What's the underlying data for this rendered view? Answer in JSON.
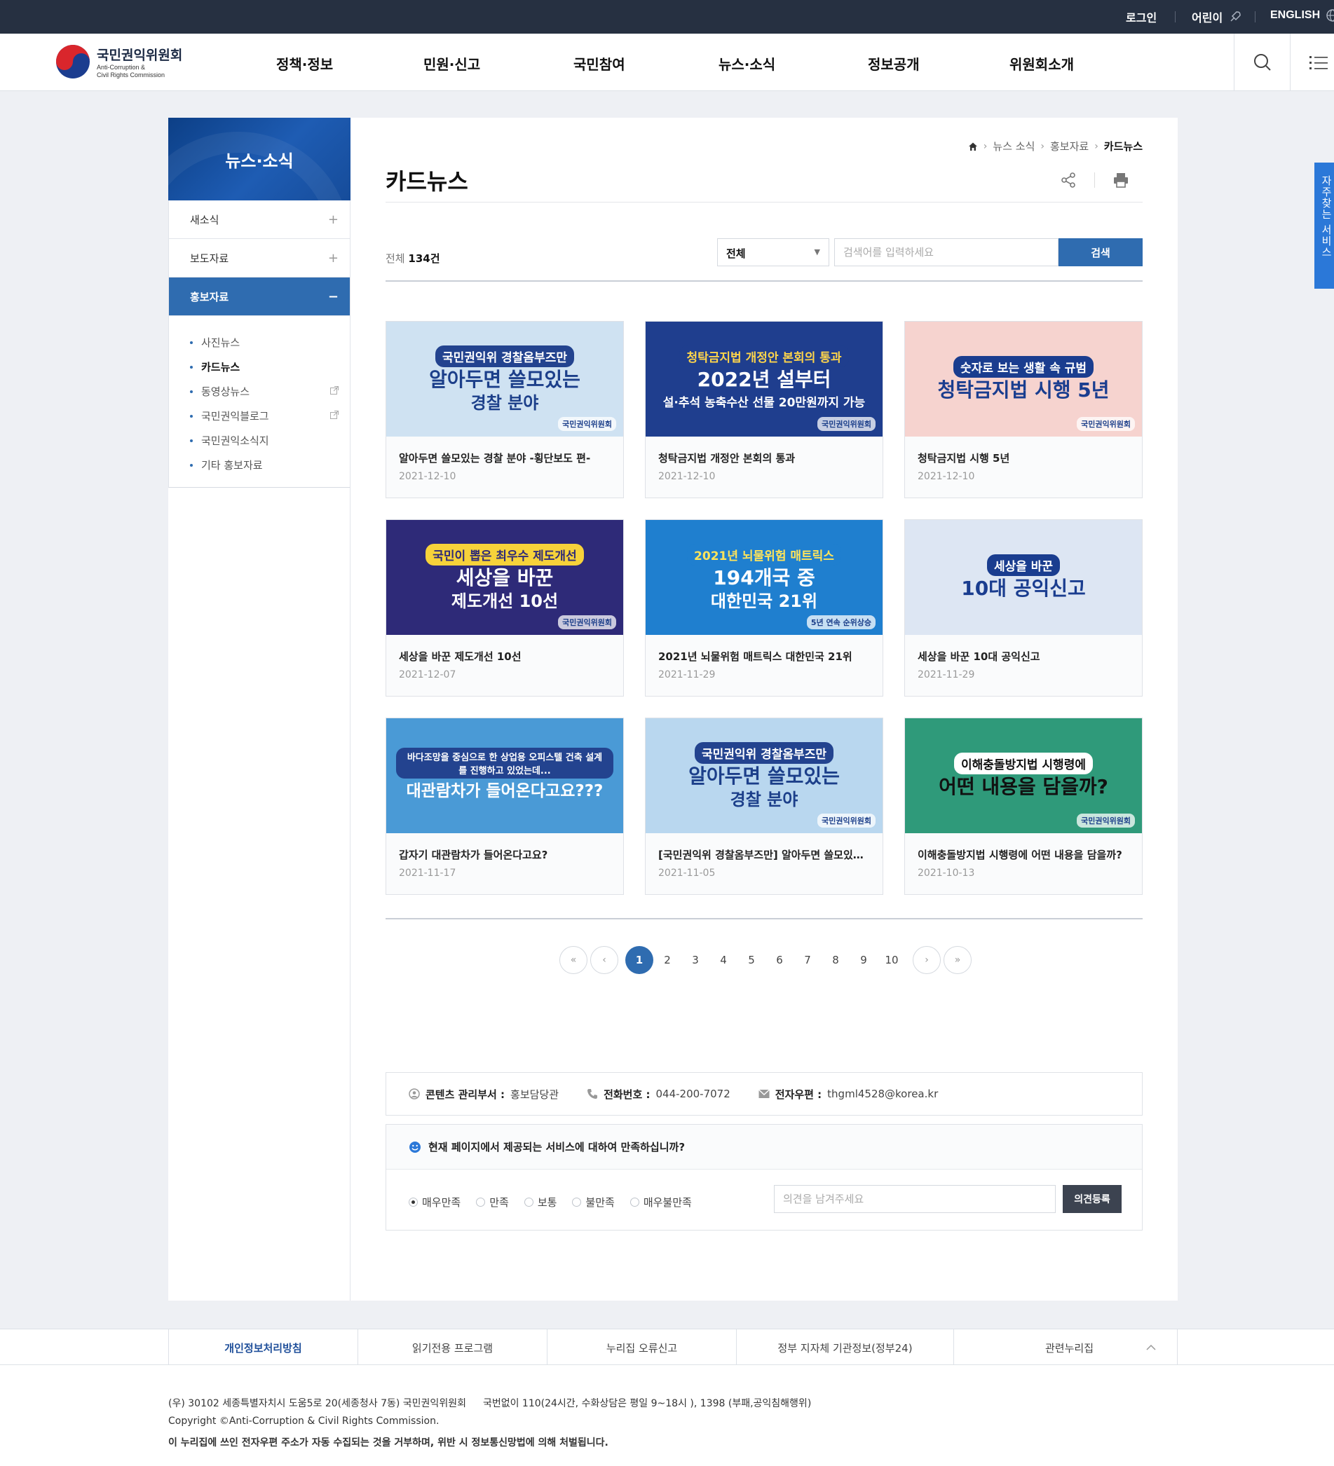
{
  "topbar": {
    "login": "로그인",
    "kids": "어린이",
    "english": "ENGLISH"
  },
  "logo": {
    "name_ko": "국민권익위원회",
    "name_en_1": "Anti-Corruption &",
    "name_en_2": "Civil Rights Commission"
  },
  "gnb": [
    "정책·정보",
    "민원·신고",
    "국민참여",
    "뉴스·소식",
    "정보공개",
    "위원회소개"
  ],
  "quick_tab": "자주찾는 서비스",
  "lnb": {
    "title": "뉴스·소식",
    "items": [
      {
        "label": "새소식",
        "sign": "+"
      },
      {
        "label": "보도자료",
        "sign": "+"
      },
      {
        "label": "홍보자료",
        "sign": "−"
      }
    ],
    "sub_items": [
      "사진뉴스",
      "카드뉴스",
      "동영상뉴스",
      "국민권익블로그",
      "국민권익소식지",
      "기타 홍보자료"
    ]
  },
  "breadcrumb": [
    "뉴스 소식",
    "홍보자료",
    "카드뉴스"
  ],
  "page_title": "카드뉴스",
  "list": {
    "count_label": "전체",
    "count_value": "134건",
    "select_value": "전체",
    "search_placeholder": "검색어를 입력하세요",
    "search_button": "검색"
  },
  "cards": [
    {
      "title": "알아두면 쓸모있는 경찰 분야 -횡단보도 편-",
      "date": "2021-12-10",
      "thumb": {
        "t1": "국민권익위 경찰옴부즈만",
        "t2": "알아두면 쓸모있는",
        "t3": "경찰 분야",
        "brand": "국민권익위원회",
        "bg": "#cfe2f2",
        "fg": "#1c3f8a",
        "pill": "#23438f",
        "pillfg": "#ffffff"
      }
    },
    {
      "title": "청탁금지법 개정안 본회의 통과",
      "date": "2021-12-10",
      "thumb": {
        "t1": "청탁금지법 개정안 본회의 통과",
        "t2": "2022년 설부터",
        "t3": "설·추석 농축수산 선물 20만원까지 가능",
        "brand": "국민권익위원회",
        "bg": "#1f3e8e",
        "fg": "#ffffff",
        "pill": "#1f3e8e",
        "pillfg": "#ffd54a"
      }
    },
    {
      "title": "청탁금지법 시행 5년",
      "date": "2021-12-10",
      "thumb": {
        "t1": "숫자로 보는 생활 속 규범",
        "t2": "청탁금지법 시행 5년",
        "t3": "",
        "brand": "국민권익위원회",
        "bg": "#f6d3cf",
        "fg": "#1a3d8f",
        "pill": "#1a3d8f",
        "pillfg": "#ffffff"
      }
    },
    {
      "title": "세상을 바꾼 제도개선 10선",
      "date": "2021-12-07",
      "thumb": {
        "t1": "국민이 뽑은 최우수 제도개선",
        "t2": "세상을 바꾼",
        "t3": "제도개선 10선",
        "brand": "국민권익위원회",
        "bg": "#2e2a78",
        "fg": "#ffffff",
        "pill": "#f7d23a",
        "pillfg": "#2e2a78"
      }
    },
    {
      "title": "2021년 뇌물위험 매트릭스 대한민국 21위",
      "date": "2021-11-29",
      "thumb": {
        "t1": "2021년 뇌물위험 매트릭스",
        "t2": "194개국 중",
        "t3": "대한민국 21위",
        "brand": "5년 연속 순위상승",
        "bg": "#1f7fcf",
        "fg": "#ffffff",
        "pill": "#1f7fcf",
        "pillfg": "#ffe45a"
      }
    },
    {
      "title": "세상을 바꾼 10대 공익신고",
      "date": "2021-11-29",
      "thumb": {
        "t1": "세상을 바꾼",
        "t2": "10대 공익신고",
        "t3": "",
        "brand": "",
        "bg": "#dde6f3",
        "fg": "#1a3d8f",
        "pill": "#1a3d8f",
        "pillfg": "#ffffff"
      }
    },
    {
      "title": "갑자기 대관람차가 들어온다고요?",
      "date": "2021-11-17",
      "thumb": {
        "t1": "바다조망을 중심으로 한 상업용 오피스텔 건축 설계를 진행하고 있었는데...",
        "t2": "대관람차가 들어온다고요???",
        "t3": "",
        "brand": "",
        "bg": "#4a9ad6",
        "fg": "#ffffff",
        "pill": "#23438f",
        "pillfg": "#ffffff"
      }
    },
    {
      "title": "[국민권익위 경찰옴부즈만] 알아두면 쓸모있는 경찰 분야 -집회시위 편-",
      "date": "2021-11-05",
      "thumb": {
        "t1": "국민권익위 경찰옴부즈만",
        "t2": "알아두면 쓸모있는",
        "t3": "경찰 분야",
        "brand": "국민권익위원회",
        "bg": "#b9d7ef",
        "fg": "#1c3f8a",
        "pill": "#23438f",
        "pillfg": "#ffffff"
      }
    },
    {
      "title": "이해충돌방지법 시행령에 어떤 내용을 담을까?",
      "date": "2021-10-13",
      "thumb": {
        "t1": "이해충돌방지법 시행령에",
        "t2": "어떤 내용을 담을까?",
        "t3": "",
        "brand": "국민권익위원회",
        "bg": "#2f9a7a",
        "fg": "#111111",
        "pill": "#ffffff",
        "pillfg": "#111111"
      }
    }
  ],
  "pager": {
    "pages": [
      "1",
      "2",
      "3",
      "4",
      "5",
      "6",
      "7",
      "8",
      "9",
      "10"
    ],
    "current": "1"
  },
  "contact": {
    "dept_label": "콘텐츠 관리부서 :",
    "dept_value": "홍보담당관",
    "tel_label": "전화번호 :",
    "tel_value": "044-200-7072",
    "mail_label": "전자우편 :",
    "mail_value": "thgml4528@korea.kr"
  },
  "survey": {
    "question": "현재 페이지에서 제공되는 서비스에 대하여 만족하십니까?",
    "options": [
      "매우만족",
      "만족",
      "보통",
      "불만족",
      "매우불만족"
    ],
    "selected": "매우만족",
    "placeholder": "의견을 남겨주세요",
    "button": "의견등록"
  },
  "footer": {
    "links": [
      "개인정보처리방침",
      "읽기전용 프로그램",
      "누리집 오류신고",
      "정부 지자체 기관정보(정부24)"
    ],
    "related": "관련누리집",
    "address": "(우) 30102 세종특별자치시 도움5로 20(세종청사 7동) 국민권익위원회",
    "phone": "국번없이 110(24시간, 수화상담은 평일 9~18시 ), 1398 (부패,공익침해행위)",
    "copyright": "Copyright ©Anti-Corruption & Civil Rights Commission.",
    "notice": "이 누리집에 쓰인 전자우편 주소가 자동 수집되는 것을 거부하며, 위반 시 정보통신망법에 의해 처벌됩니다."
  },
  "colors": {
    "primary": "#2f6cb0",
    "topbar": "#263041",
    "quick": "#2b78d8"
  }
}
